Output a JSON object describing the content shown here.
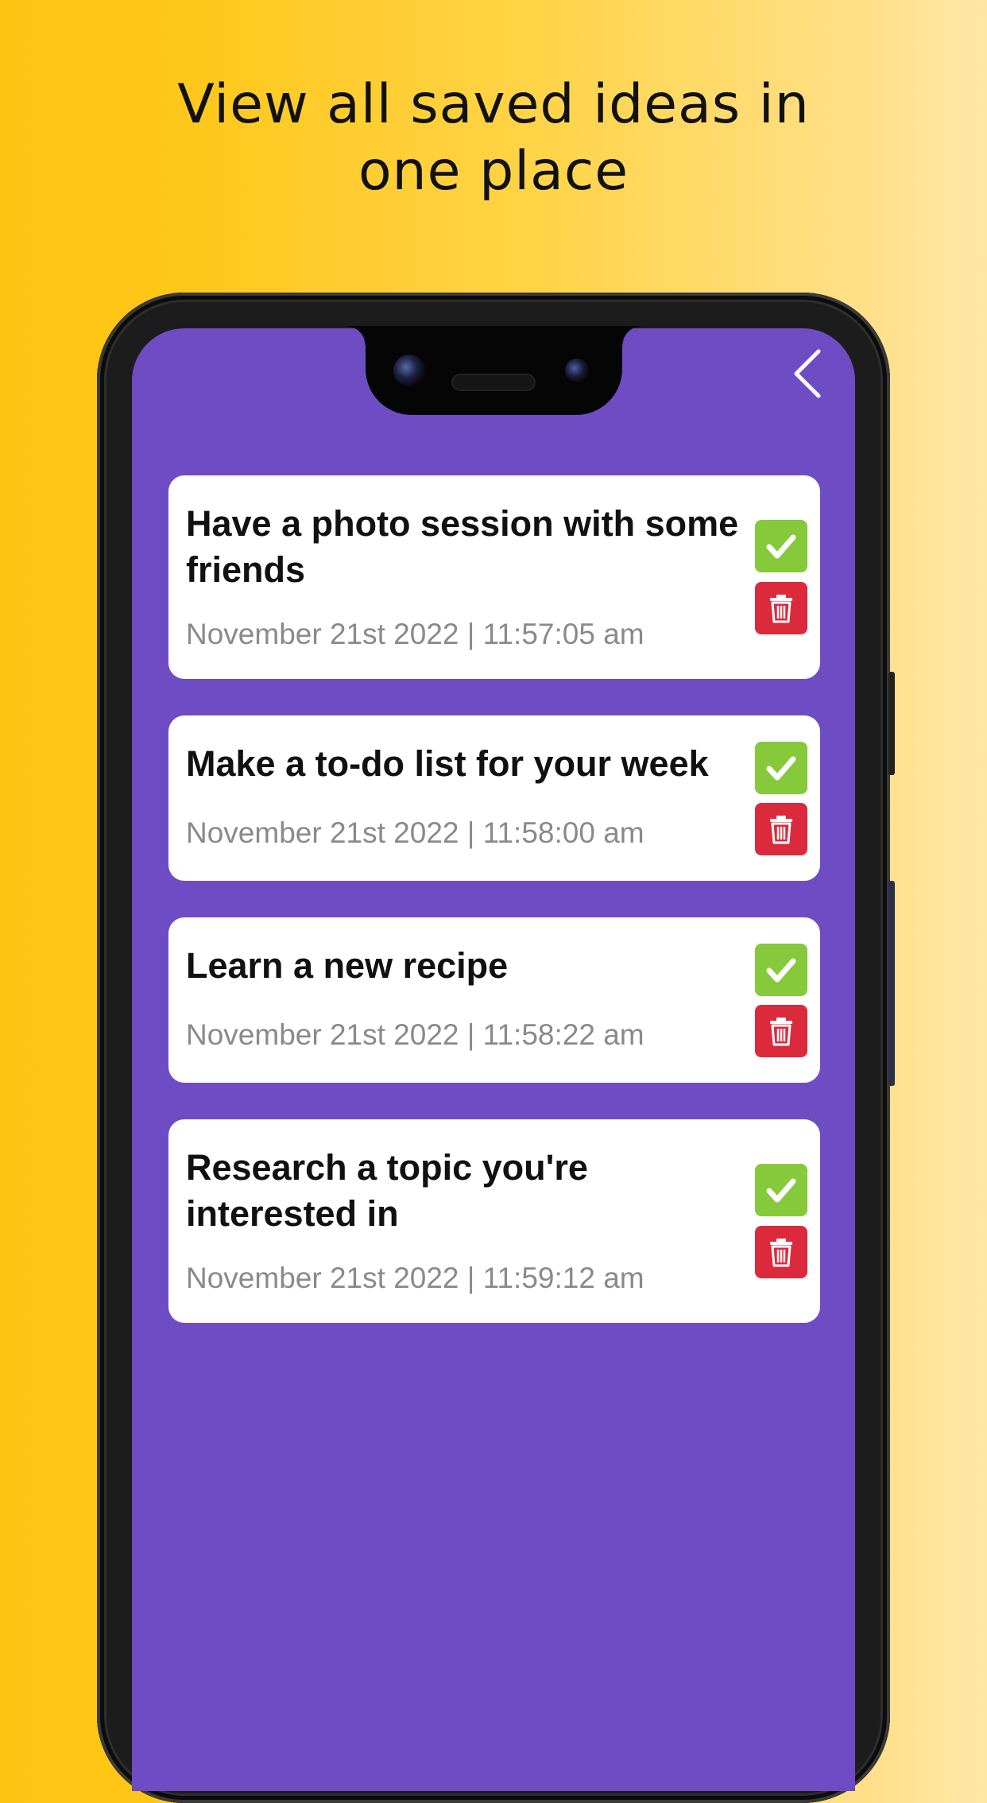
{
  "headline": {
    "line1": "View all saved ideas in",
    "line2": "one place"
  },
  "colors": {
    "screen_background": "#6e4dc4",
    "done_button": "#86c93a",
    "delete_button": "#dc2a3d",
    "date_text": "#8a8a8a"
  },
  "header": {
    "back_icon": "chevron-left-icon"
  },
  "ideas": [
    {
      "title": "Have a photo session with some friends",
      "date": "November 21st 2022 | 11:57:05 am",
      "done_icon": "checkmark-icon",
      "delete_icon": "trash-icon"
    },
    {
      "title": "Make a to-do list for your week",
      "date": "November 21st 2022 | 11:58:00 am",
      "done_icon": "checkmark-icon",
      "delete_icon": "trash-icon"
    },
    {
      "title": "Learn a new recipe",
      "date": "November 21st 2022 | 11:58:22 am",
      "done_icon": "checkmark-icon",
      "delete_icon": "trash-icon"
    },
    {
      "title": "Research a topic you're interested in",
      "date": "November 21st 2022 | 11:59:12 am",
      "done_icon": "checkmark-icon",
      "delete_icon": "trash-icon"
    }
  ]
}
